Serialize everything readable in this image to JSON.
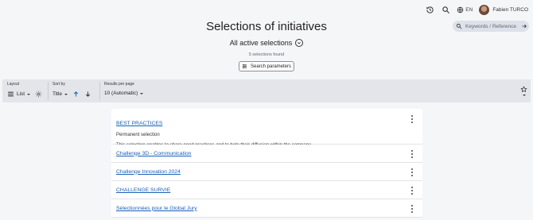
{
  "header": {
    "history_icon": "history-icon",
    "search_icon": "search-icon",
    "language": "EN",
    "user_name": "Fabien TURCO"
  },
  "page": {
    "title": "Selections of initiatives",
    "subtitle": "All active selections",
    "count_text": "5 selections found",
    "search_params_label": "Search parameters"
  },
  "search": {
    "placeholder": "Keywords / Reference"
  },
  "toolbar": {
    "layout_label": "Layout",
    "layout_value": "List",
    "sort_label": "Sort by",
    "sort_value": "Title",
    "results_label": "Results per page",
    "results_value": "10 (Automatic)"
  },
  "results": [
    {
      "title": "BEST PRACTICES",
      "subtitle": "Permanent selection",
      "description": "This selection enables to share good practices and to help their diffusion within the company."
    },
    {
      "title": "Challenge 3D - Communication"
    },
    {
      "title": "Challenge Innovation 2024"
    },
    {
      "title": "CHALLENGE SURVIE"
    },
    {
      "title": "Sélectionnées pour le Global Jury"
    }
  ],
  "colors": {
    "link": "#1a5fb4",
    "accent_blue": "#1a5fb4",
    "toolbar_bg": "#e3e5ea",
    "search_bg": "#dde1ea"
  }
}
